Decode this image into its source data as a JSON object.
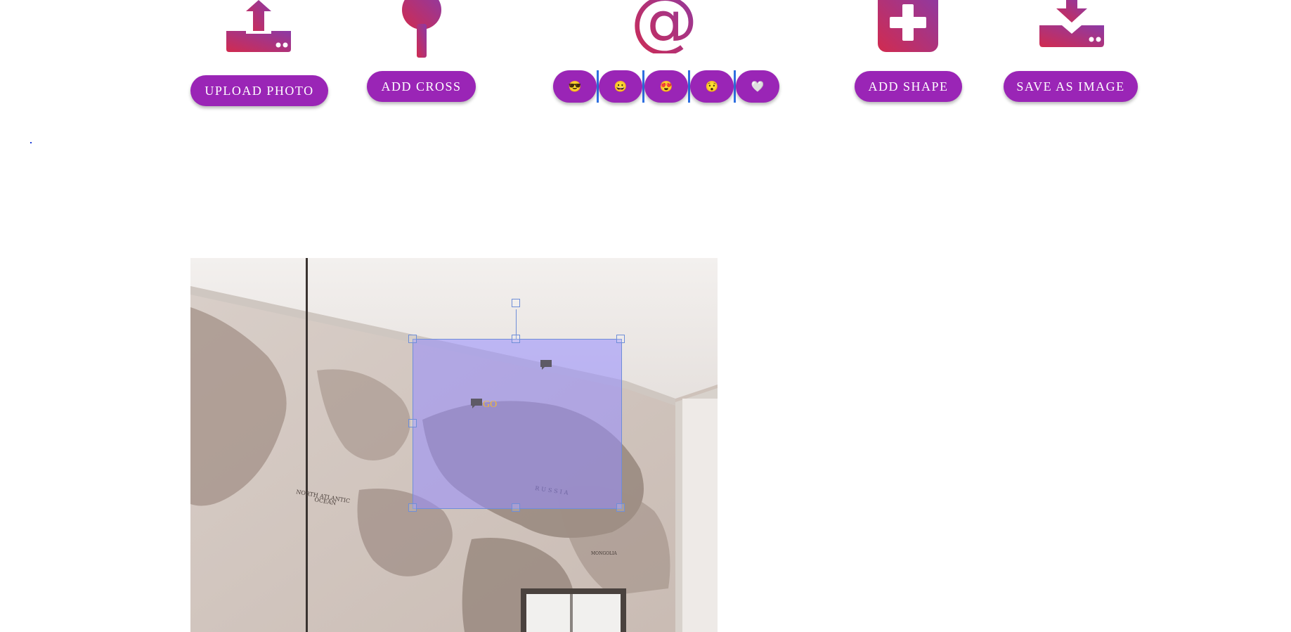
{
  "toolbar": {
    "upload": {
      "label": "UPLOAD PHOTO",
      "icon": "upload-tray-icon"
    },
    "cross": {
      "label": "ADD CROSS",
      "icon": "map-pin-icon"
    },
    "emoji": {
      "icon": "at-sign-icon",
      "items": [
        {
          "glyph": "😎",
          "name": "sunglasses"
        },
        {
          "glyph": "😀",
          "name": "grin"
        },
        {
          "glyph": "😍",
          "name": "heart-eyes"
        },
        {
          "glyph": "😯",
          "name": "hushed"
        },
        {
          "glyph": "🤍",
          "name": "heart"
        }
      ]
    },
    "shape": {
      "label": "ADD SHAPE",
      "icon": "plus-square-icon"
    },
    "save": {
      "label": "SAVE AS IMAGE",
      "icon": "download-tray-icon"
    }
  },
  "canvas": {
    "image": "world-map-wallpaper-room",
    "map_labels": {
      "north_atlantic": "NORTH ATLANTIC OCEAN",
      "russia": "RUSSIA",
      "mongolia": "MONGOLIA"
    },
    "selection": {
      "text_marker": "GO"
    }
  },
  "colors": {
    "button_purple": "#9a25b6",
    "icon_gradient_start": "#c72f55",
    "icon_gradient_end": "#8a3aa8",
    "selection_fill": "#968cff",
    "marker_text": "#f0b838"
  }
}
